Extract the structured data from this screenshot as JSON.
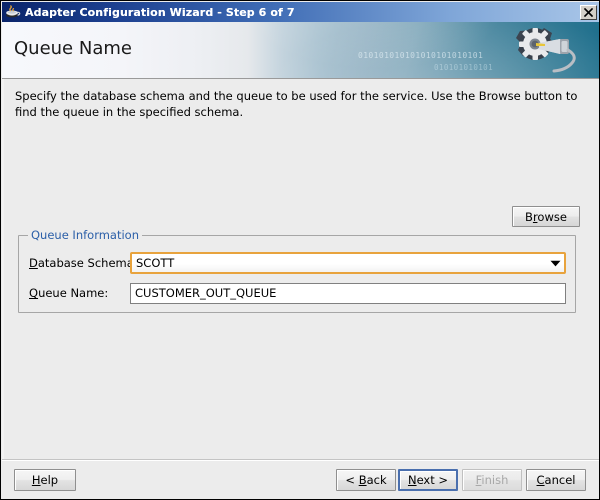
{
  "titlebar": {
    "icon": "java-coffee-cup-icon",
    "title": "Adapter Configuration Wizard - Step 6 of 7",
    "close_label": "✕"
  },
  "banner": {
    "heading": "Queue Name",
    "binary_line1": "010101010101010101010101",
    "binary_line2": "010101010101",
    "art": "gear-wrench-icon"
  },
  "content": {
    "instructions": "Specify the database schema and the queue to be used for the service. Use the Browse button to find the queue in the specified schema.",
    "browse_label": "Browse"
  },
  "group": {
    "legend": "Queue Information",
    "schema": {
      "label_pre": "D",
      "label_post": "atabase Schema:",
      "value": "SCOTT",
      "arrow": "▼"
    },
    "queue": {
      "label_pre": "Q",
      "label_post": "ueue Name:",
      "value": "CUSTOMER_OUT_QUEUE"
    }
  },
  "footer": {
    "help": {
      "pre": "H",
      "mn": "",
      "post": "elp",
      "mnemonic": "H"
    },
    "back": {
      "label": "< Back",
      "mnemonic": "B"
    },
    "next": {
      "label": "Next >",
      "mnemonic": "N"
    },
    "finish": {
      "label": "Finish",
      "mnemonic": "F",
      "disabled_note": "disabled"
    },
    "cancel": {
      "label": "Cancel",
      "mnemonic": "C"
    }
  },
  "colors": {
    "title_start": "#0a246a",
    "title_end": "#a9c6e8",
    "dialog_bg": "#ececec",
    "legend_blue": "#2b5fa8",
    "combo_highlight": "#e8a33d",
    "focus_blue": "#4a6fae",
    "disabled_text": "#a8a8a8"
  }
}
